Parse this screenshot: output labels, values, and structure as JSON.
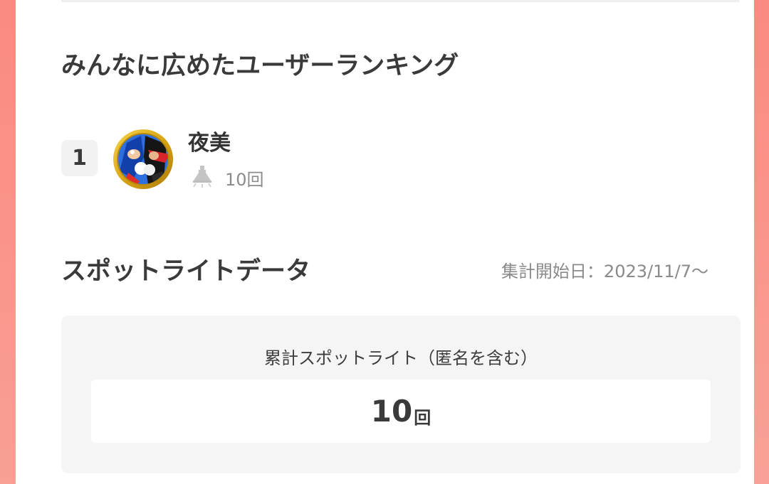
{
  "ranking": {
    "title": "みんなに広めたユーザーランキング",
    "entries": [
      {
        "rank": "1",
        "name": "夜美",
        "count": "10回"
      }
    ]
  },
  "spotlight": {
    "title": "スポットライトデータ",
    "start_date": "集計開始日：2023/11/7〜",
    "total_label": "累計スポットライト（匿名を含む）",
    "total_value": "10",
    "total_unit": "回"
  },
  "colors": {
    "background_side": "#fa8a80",
    "card": "#ffffff",
    "panel": "#f5f5f5",
    "text": "#3a3a3a",
    "muted": "#8a8a8a"
  },
  "icons": {
    "bell": "spotlight-bell-icon",
    "avatar": "user-avatar"
  }
}
